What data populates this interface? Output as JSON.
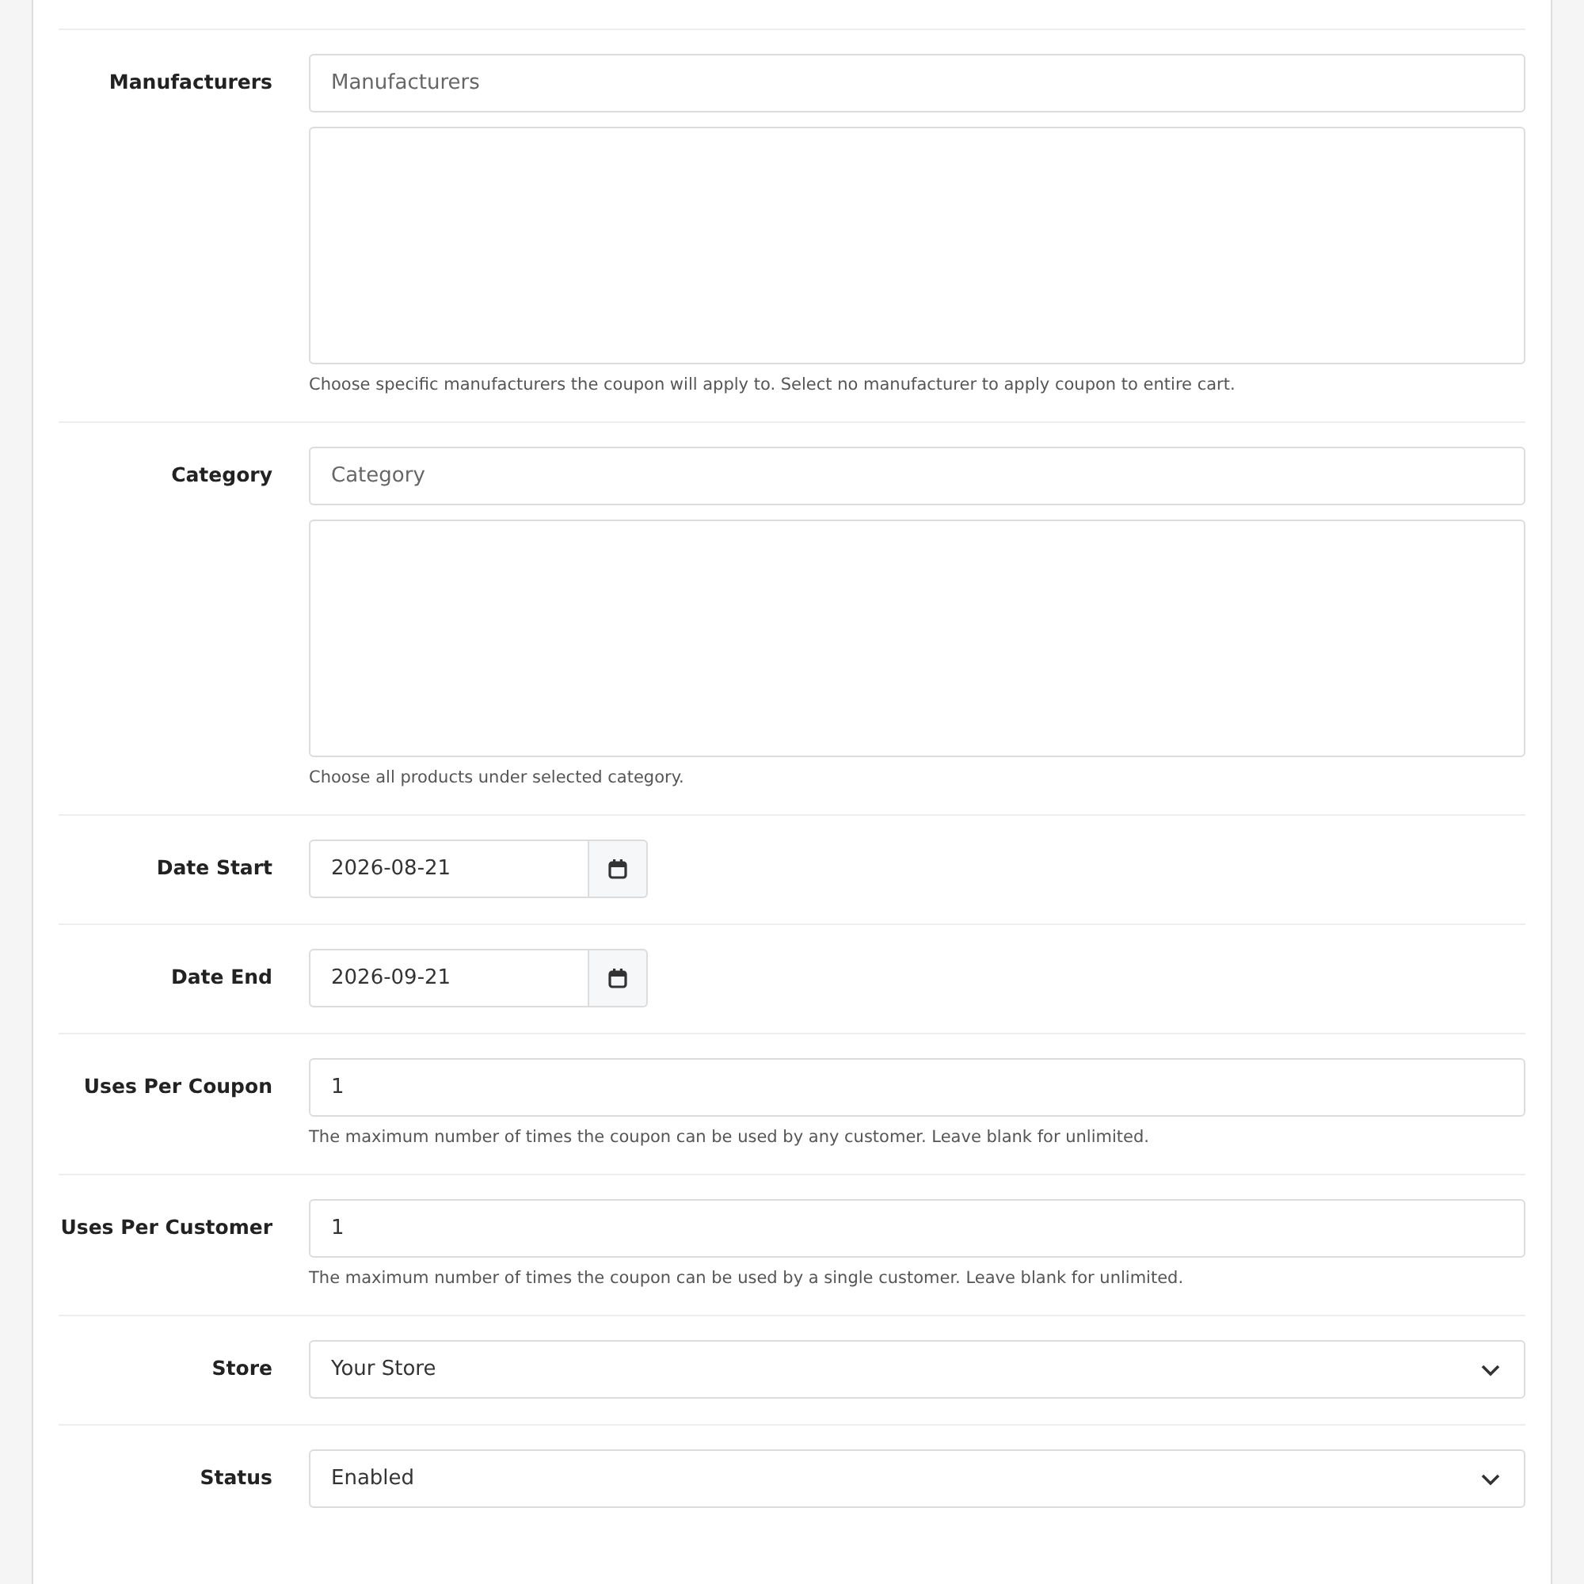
{
  "fields": [
    {
      "kind": "autocomplete",
      "label": "Manufacturers",
      "placeholder": "Manufacturers",
      "help": "Choose specific manufacturers the coupon will apply to. Select no manufacturer to apply coupon to entire cart."
    },
    {
      "kind": "autocomplete",
      "label": "Category",
      "placeholder": "Category",
      "help": "Choose all products under selected category."
    },
    {
      "kind": "date",
      "label": "Date Start",
      "value": "2026-08-21"
    },
    {
      "kind": "date",
      "label": "Date End",
      "value": "2026-09-21"
    },
    {
      "kind": "text",
      "label": "Uses Per Coupon",
      "value": "1",
      "help": "The maximum number of times the coupon can be used by any customer. Leave blank for unlimited."
    },
    {
      "kind": "text",
      "label": "Uses Per Customer",
      "value": "1",
      "help": "The maximum number of times the coupon can be used by a single customer. Leave blank for unlimited."
    },
    {
      "kind": "select",
      "label": "Store",
      "value": "Your Store"
    },
    {
      "kind": "select",
      "label": "Status",
      "value": "Enabled"
    }
  ]
}
